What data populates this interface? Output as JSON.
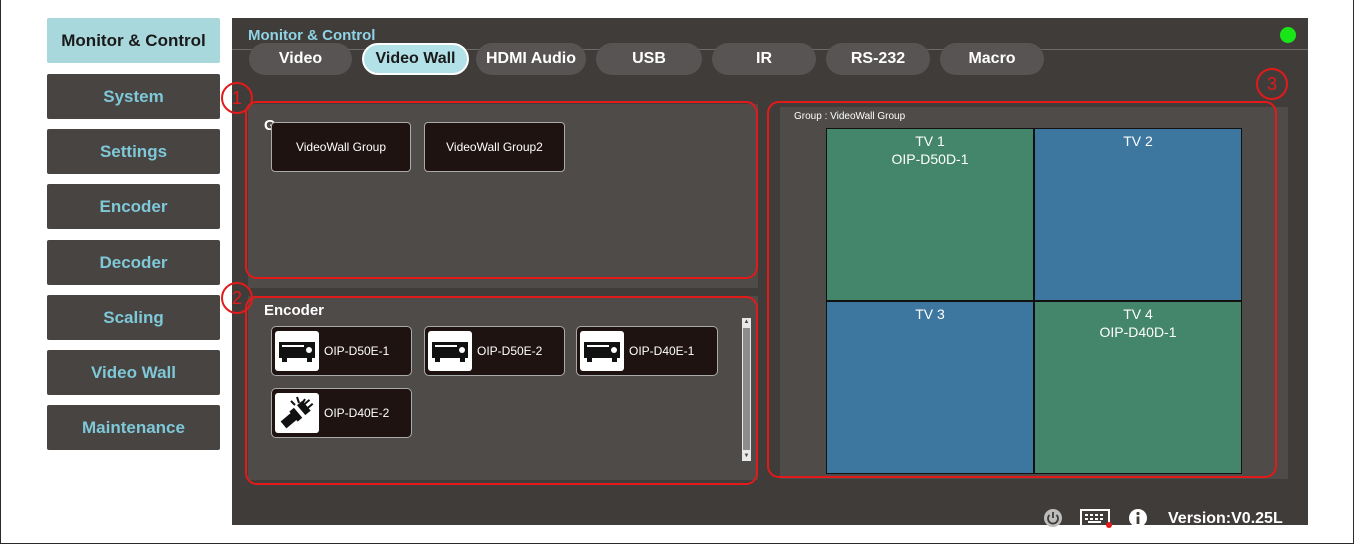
{
  "sidebar": {
    "items": [
      {
        "label": "Monitor & Control",
        "active": true
      },
      {
        "label": "System"
      },
      {
        "label": "Settings"
      },
      {
        "label": "Encoder"
      },
      {
        "label": "Decoder"
      },
      {
        "label": "Scaling"
      },
      {
        "label": "Video Wall"
      },
      {
        "label": "Maintenance"
      }
    ]
  },
  "header": {
    "title": "Monitor & Control",
    "status_color": "#19e619"
  },
  "tabs": [
    {
      "label": "Video"
    },
    {
      "label": "Video Wall",
      "active": true
    },
    {
      "label": "HDMI Audio"
    },
    {
      "label": "USB"
    },
    {
      "label": "IR"
    },
    {
      "label": "RS-232"
    },
    {
      "label": "Macro"
    }
  ],
  "group_panel": {
    "title": "Group",
    "groups": [
      "VideoWall Group",
      "VideoWall Group2"
    ]
  },
  "encoder_panel": {
    "title": "Encoder",
    "encoders": [
      {
        "label": "OIP-D50E-1",
        "icon": "encoder-device-icon"
      },
      {
        "label": "OIP-D50E-2",
        "icon": "encoder-device-icon"
      },
      {
        "label": "OIP-D40E-1",
        "icon": "encoder-device-icon"
      },
      {
        "label": "OIP-D40E-2",
        "icon": "disconnected-plug-icon"
      }
    ]
  },
  "video_wall": {
    "group_label": "Group : VideoWall Group",
    "tvs": [
      {
        "name": "TV 1",
        "source": "OIP-D50D-1",
        "color": "#44866c"
      },
      {
        "name": "TV 2",
        "source": "",
        "color": "#3d77a0"
      },
      {
        "name": "TV 3",
        "source": "",
        "color": "#3d77a0"
      },
      {
        "name": "TV 4",
        "source": "OIP-D40D-1",
        "color": "#44866c"
      }
    ]
  },
  "annotations": [
    "1",
    "2",
    "3"
  ],
  "annotation_color": "#e21a1a",
  "footer": {
    "version": "Version:V0.25L",
    "icons": [
      "power-icon",
      "keyboard-icon",
      "info-icon"
    ]
  }
}
